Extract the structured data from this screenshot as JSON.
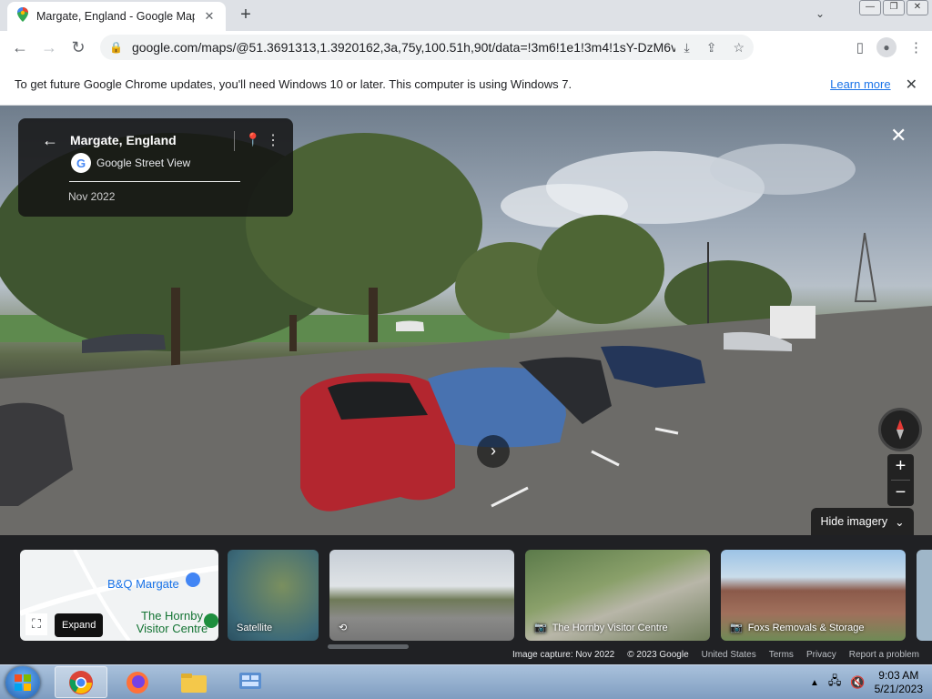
{
  "browser": {
    "tab_title": "Margate, England - Google Maps",
    "tab_close": "✕",
    "new_tab": "+",
    "url": "google.com/maps/@51.3691313,1.3920162,3a,75y,100.51h,90t/data=!3m6!1e1!3m4!1sY-DzM6vnk12ipLGM...",
    "window_buttons": [
      "—",
      "❐",
      "✕"
    ]
  },
  "infobar": {
    "message": "To get future Google Chrome updates, you'll need Windows 10 or later. This computer is using Windows 7.",
    "link": "Learn more",
    "close": "✕"
  },
  "street_view": {
    "place": "Margate, England",
    "provider": "Google Street View",
    "date": "Nov 2022",
    "hide_imagery": "Hide imagery",
    "zoom_in": "+",
    "zoom_out": "−"
  },
  "filmstrip": {
    "map_label": "B&Q Margate",
    "map_label_2": "The Hornby Visitor Centre",
    "expand_tooltip": "Expand",
    "thumbnails": [
      "Satellite",
      "",
      "The Hornby Visitor Centre",
      "Foxs Removals & Storage"
    ]
  },
  "footer": {
    "capture": "Image capture: Nov 2022",
    "copyright": "© 2023 Google",
    "region": "United States",
    "terms": "Terms",
    "privacy": "Privacy",
    "report": "Report a problem"
  },
  "taskbar": {
    "time": "9:03 AM",
    "date": "5/21/2023"
  },
  "colors": {
    "chrome_tabstrip": "#dee1e6",
    "link_blue": "#1a73e8",
    "panel_dark": "#202124"
  }
}
